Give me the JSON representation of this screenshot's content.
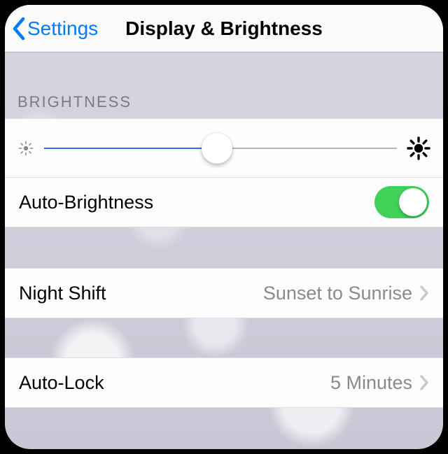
{
  "nav": {
    "back_label": "Settings",
    "title": "Display & Brightness"
  },
  "brightness": {
    "section_title": "Brightness",
    "slider_percent": 49,
    "auto_label": "Auto-Brightness",
    "auto_on": true
  },
  "night_shift": {
    "label": "Night Shift",
    "value": "Sunset to Sunrise"
  },
  "auto_lock": {
    "label": "Auto-Lock",
    "value": "5 Minutes"
  },
  "icons": {
    "sun_small": "brightness-low-icon",
    "sun_large": "brightness-high-icon"
  },
  "colors": {
    "tint": "#007aff",
    "toggle_on": "#42d158"
  }
}
